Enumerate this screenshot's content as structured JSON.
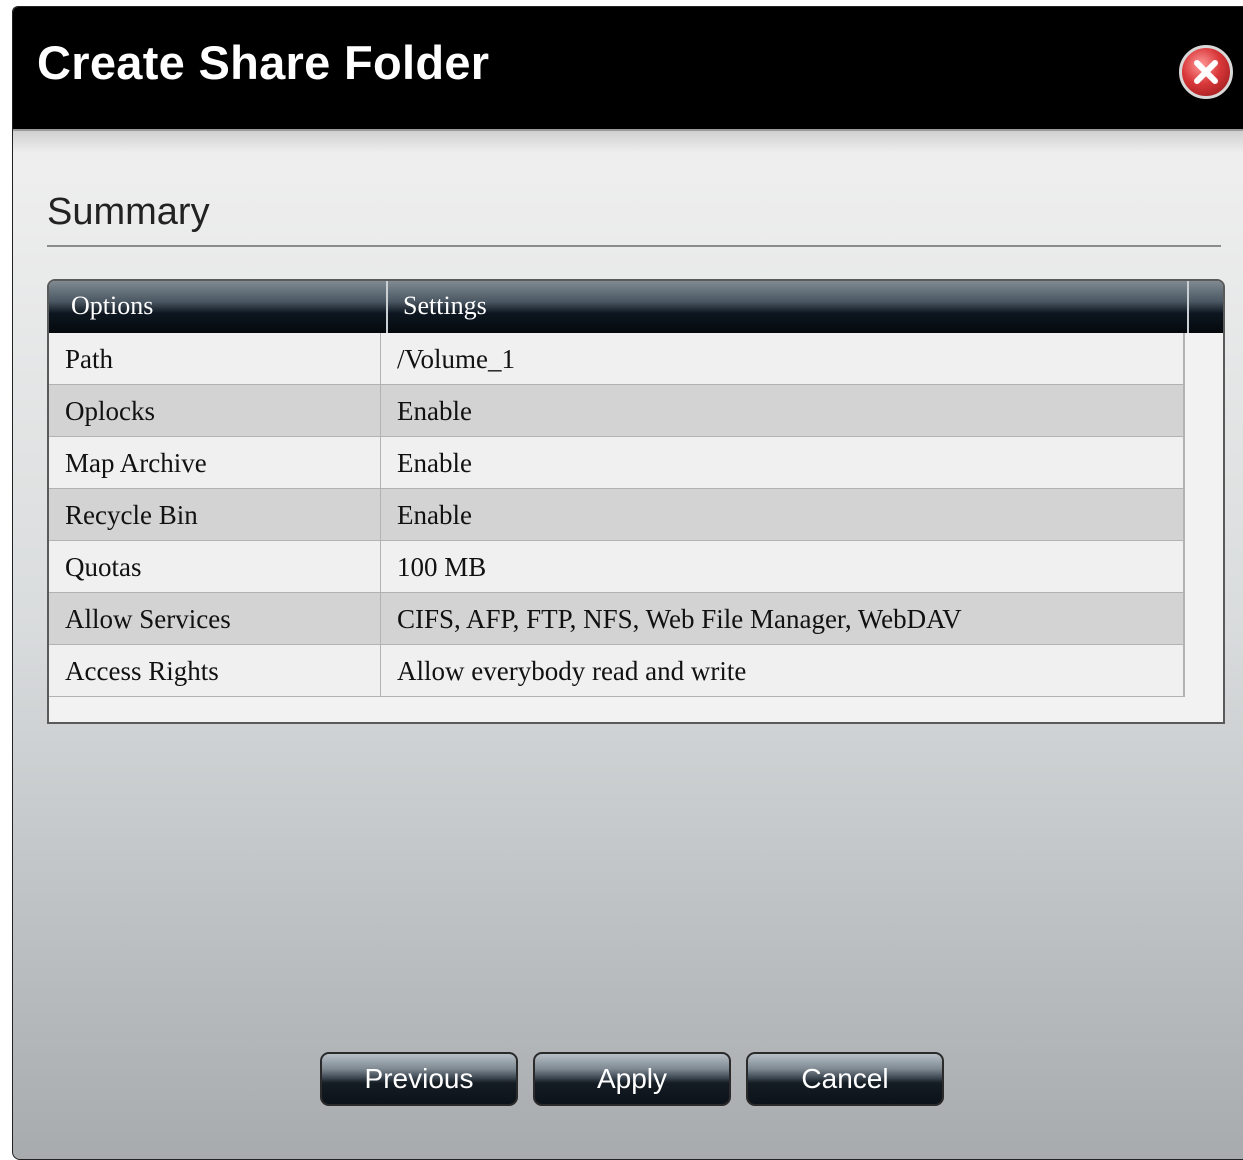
{
  "dialog": {
    "title": "Create Share Folder",
    "close_icon": "close-icon"
  },
  "summary": {
    "heading": "Summary",
    "columns": [
      "Options",
      "Settings"
    ],
    "rows": [
      {
        "option": "Path",
        "setting": "/Volume_1"
      },
      {
        "option": "Oplocks",
        "setting": "Enable"
      },
      {
        "option": "Map Archive",
        "setting": "Enable"
      },
      {
        "option": "Recycle Bin",
        "setting": "Enable"
      },
      {
        "option": "Quotas",
        "setting": "100 MB"
      },
      {
        "option": "Allow Services",
        "setting": "CIFS, AFP, FTP, NFS, Web File Manager, WebDAV"
      },
      {
        "option": "Access Rights",
        "setting": "Allow everybody read and write"
      }
    ]
  },
  "buttons": {
    "previous": "Previous",
    "apply": "Apply",
    "cancel": "Cancel"
  },
  "colors": {
    "titlebar": "#000000",
    "close_button": "#d9383a"
  }
}
